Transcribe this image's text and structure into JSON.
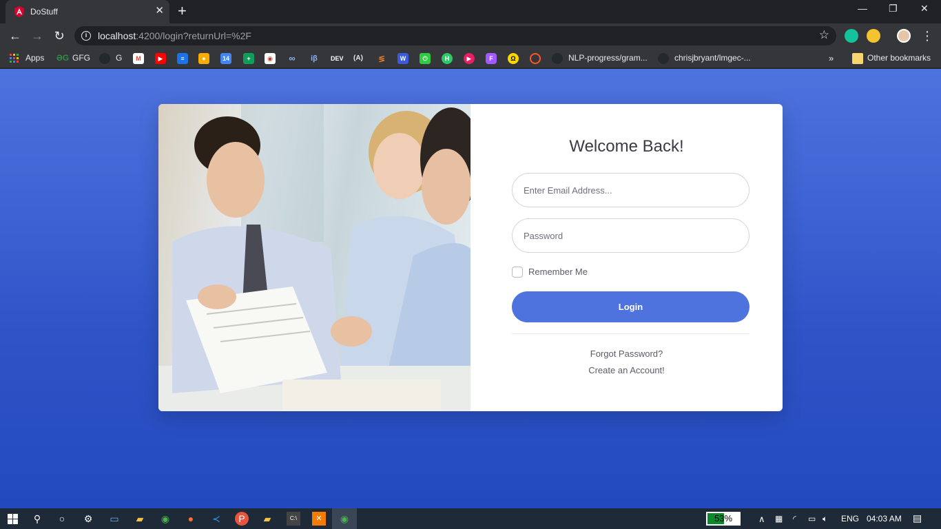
{
  "browser": {
    "tab_title": "DoStuff",
    "url_host": "localhost",
    "url_rest": ":4200/login?returnUrl=%2F",
    "bookmarks": [
      {
        "label": "Apps",
        "icon": "apps-grid-icon"
      },
      {
        "label": "GFG",
        "icon": "gfg-icon"
      },
      {
        "label": "G",
        "icon": "github-icon"
      },
      {
        "label": "DEV",
        "icon": "dev-icon"
      },
      {
        "label": "NLP-progress/gram...",
        "icon": "github-icon"
      },
      {
        "label": "chrisjbryant/lmgec-...",
        "icon": "github-icon"
      }
    ],
    "other_bookmarks": "Other bookmarks",
    "icon_calendar_day": "14"
  },
  "login": {
    "heading": "Welcome Back!",
    "email_placeholder": "Enter Email Address...",
    "password_placeholder": "Password",
    "remember_label": "Remember Me",
    "remember_checked": false,
    "login_button": "Login",
    "forgot_link": "Forgot Password?",
    "create_link": "Create an Account!"
  },
  "taskbar": {
    "battery_percent": "53%",
    "battery_level": 0.53,
    "language": "ENG",
    "time": "04:03 AM"
  },
  "colors": {
    "primary": "#4e73df",
    "page_bg_end": "#224abe"
  }
}
